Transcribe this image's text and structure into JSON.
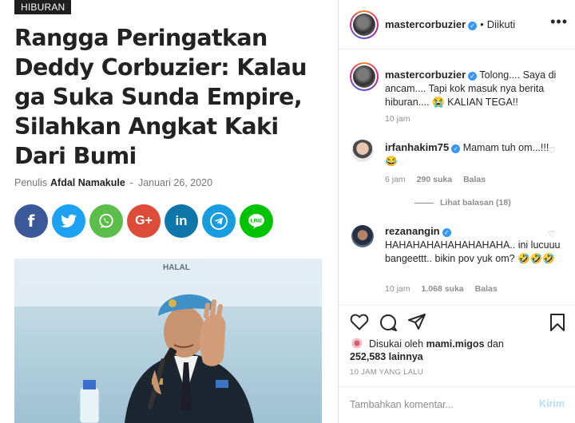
{
  "article": {
    "category": "HIBURAN",
    "headline_lines": [
      "Rangga Peringatkan",
      "Deddy Corbuzier: Kalau",
      "ga Suka Sunda Empire,",
      "Silahkan Angkat Kaki",
      "Dari Bumi"
    ],
    "author_prefix": "Penulis",
    "author": "Afdal Namakule",
    "separator": "-",
    "date": "Januari 26, 2020",
    "share_buttons": [
      {
        "icon": "facebook-icon",
        "glyph": "f",
        "color": "#3b5998"
      },
      {
        "icon": "twitter-icon",
        "glyph": "t",
        "color": "#1da1f2"
      },
      {
        "icon": "whatsapp-icon",
        "glyph": "w",
        "color": "#5cbe4a"
      },
      {
        "icon": "google-plus-icon",
        "glyph": "G+",
        "color": "#dd4b39"
      },
      {
        "icon": "linkedin-icon",
        "glyph": "in",
        "color": "#0e76a8"
      },
      {
        "icon": "telegram-icon",
        "glyph": "➤",
        "color": "#179cde"
      },
      {
        "icon": "line-icon",
        "glyph": "LINE",
        "color": "#00c300"
      }
    ],
    "photo_caption_text": "HALAL"
  },
  "instagram": {
    "header": {
      "username": "mastercorbuzier",
      "dot": "•",
      "follow_state": "Diikuti",
      "more": "•••"
    },
    "caption": {
      "username": "mastercorbuzier",
      "text": "Tolong.... Saya di ancam.... Tapi kok masuk nya berita hiburan.... 😭 KALIAN TEGA!!",
      "time": "10 jam"
    },
    "comments": [
      {
        "username": "irfanhakim75",
        "text": "Mamam tuh om...!!!😂",
        "time": "6 jam",
        "likes": "290 suka",
        "reply": "Balas"
      },
      {
        "username": "rezanangin",
        "text": "HAHAHAHAHAHAHAHAHA.. ini lucuuu bangeettt.. bikin pov yuk om? 🤣🤣🤣",
        "time": "10 jam",
        "likes": "1.068 suka",
        "reply": "Balas"
      }
    ],
    "view_replies": "Lihat balasan (18)",
    "likes": {
      "prefix": "Disukai oleh",
      "user": "mami.migos",
      "and": "dan",
      "count": "252,583 lainnya"
    },
    "posted_ago": "10 JAM YANG LALU",
    "comment_placeholder": "Tambahkan komentar...",
    "post_label": "Kirim"
  }
}
